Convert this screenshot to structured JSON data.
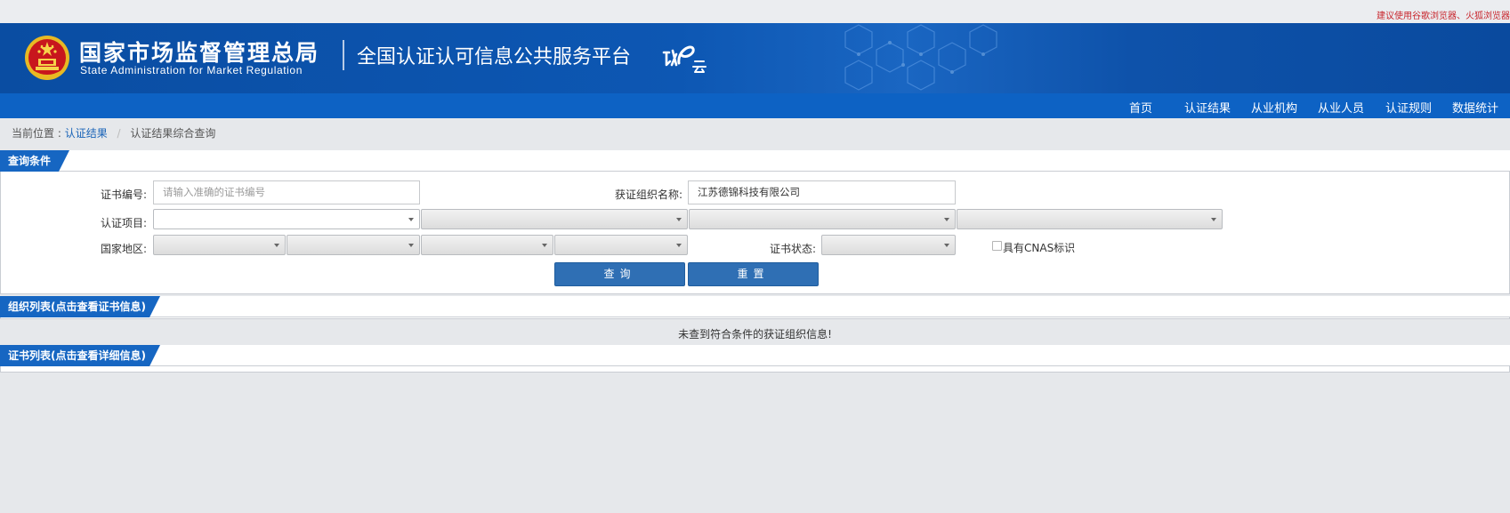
{
  "top_tip": "建议使用谷歌浏览器、火狐浏览器",
  "header": {
    "org_name_cn": "国家市场监督管理总局",
    "org_name_en": "State Administration  for  Market Regulation",
    "platform_title": "全国认证认可信息公共服务平台",
    "emblem_icon": "national-emblem-icon",
    "logo_icon": "renzheng-yun-logo-icon"
  },
  "nav": {
    "items": [
      "首页",
      "认证结果",
      "从业机构",
      "从业人员",
      "认证规则",
      "数据统计"
    ]
  },
  "breadcrumb": {
    "prefix": "当前位置 :",
    "level1": "认证结果",
    "separator": "/",
    "level2": "认证结果综合查询"
  },
  "query_panel": {
    "title": "查询条件",
    "cert_no_label": "证书编号:",
    "cert_no_placeholder": "请输入准确的证书编号",
    "org_name_label": "获证组织名称:",
    "org_name_value": "江苏德锦科技有限公司",
    "project_label": "认证项目:",
    "region_label": "国家地区:",
    "status_label": "证书状态:",
    "cnas_label": "具有CNAS标识",
    "search_button": "查询",
    "reset_button": "重置"
  },
  "org_panel": {
    "title": "组织列表(点击查看证书信息)",
    "empty_message": "未查到符合条件的获证组织信息!"
  },
  "cert_panel": {
    "title": "证书列表(点击查看详细信息)"
  },
  "colors": {
    "banner_blue": "#0d57b3",
    "nav_blue": "#0d62c4",
    "tab_blue": "#1666c2",
    "button_blue": "#2f6fb4",
    "link_blue": "#1a64b8",
    "tip_red": "#c8252c",
    "page_bg": "#e6e8eb"
  }
}
